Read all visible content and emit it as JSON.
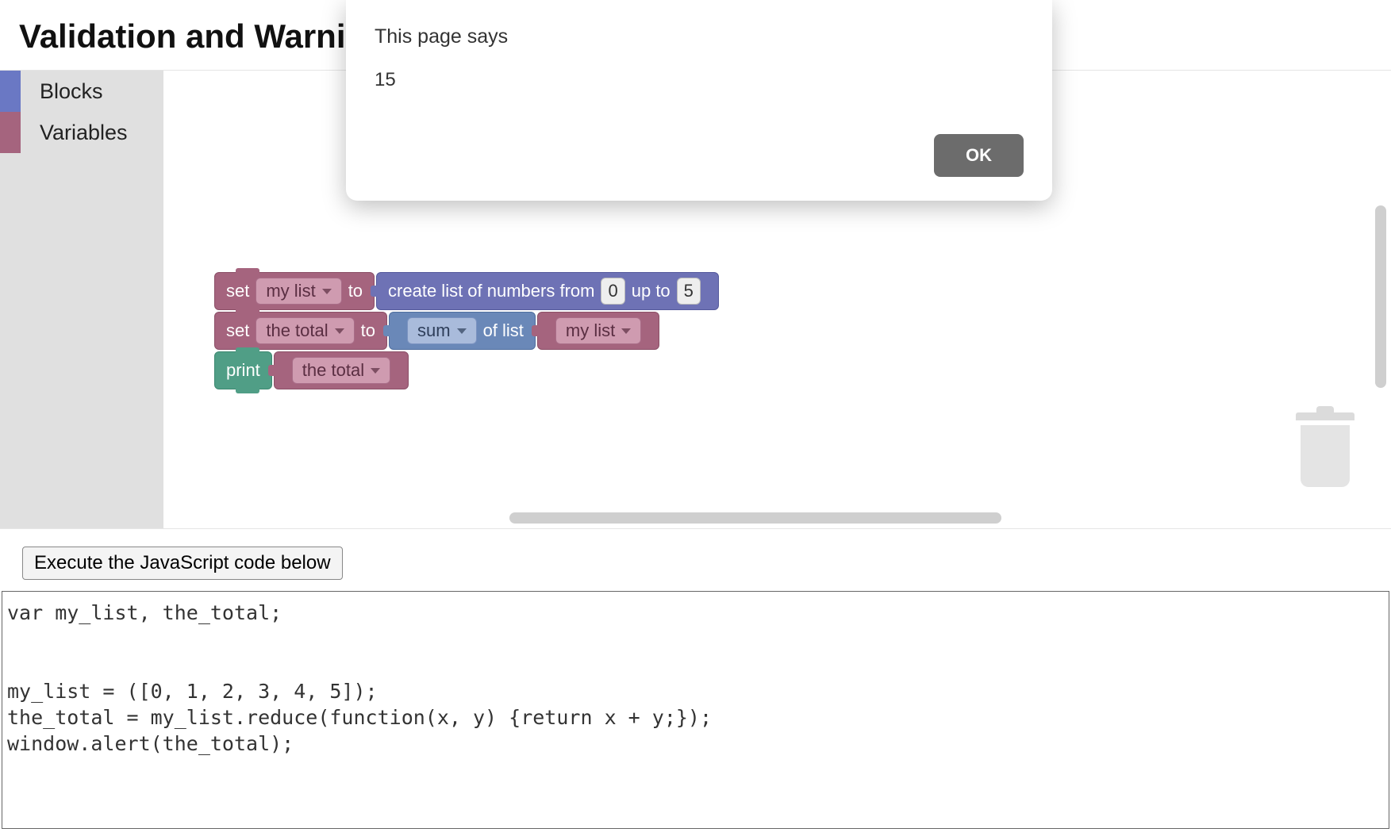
{
  "page_title": "Validation and Warni",
  "toolbox": {
    "items": [
      {
        "label": "Blocks"
      },
      {
        "label": "Variables"
      }
    ]
  },
  "dialog": {
    "title": "This page says",
    "message": "15",
    "ok_label": "OK"
  },
  "blocks": {
    "row1": {
      "set": "set",
      "var": "my list",
      "to": "to",
      "create_pre": "create list of numbers from",
      "from_val": "0",
      "upto": "up to",
      "to_val": "5"
    },
    "row2": {
      "set": "set",
      "var": "the total",
      "to": "to",
      "aggregate": "sum",
      "oflist": "of list",
      "listvar": "my list"
    },
    "row3": {
      "print": "print",
      "var": "the total"
    }
  },
  "exec_btn": "Execute the JavaScript code below",
  "code": "var my_list, the_total;\n\n\nmy_list = ([0, 1, 2, 3, 4, 5]);\nthe_total = my_list.reduce(function(x, y) {return x + y;});\nwindow.alert(the_total);"
}
